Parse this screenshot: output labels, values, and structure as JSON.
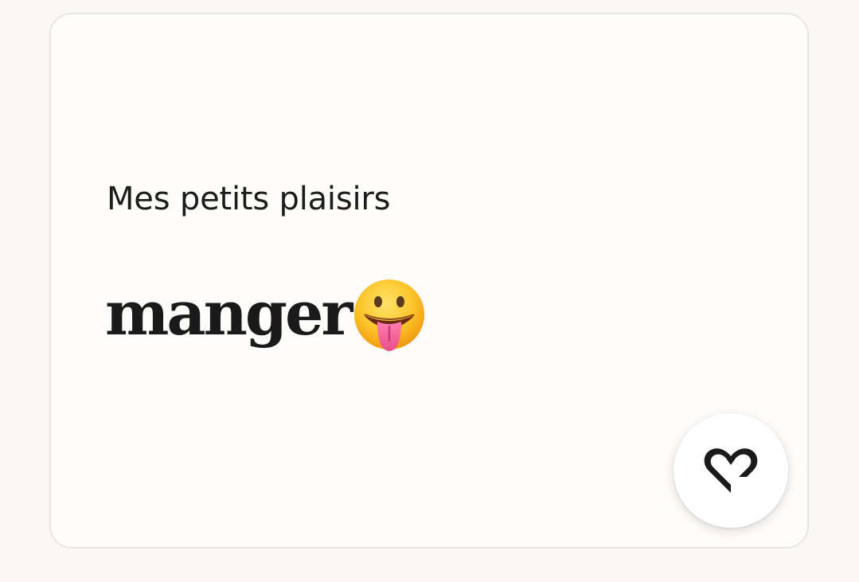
{
  "card": {
    "prompt": "Mes petits plaisirs",
    "answer": "manger",
    "answer_emoji": "face-with-tongue"
  },
  "like_button": {
    "icon": "heart-like-icon",
    "icon_color": "#1a1a1a"
  },
  "colors": {
    "page_background": "#f9f8f7",
    "card_background": "#fefdfb",
    "card_border": "#e8e6e3",
    "text": "#1a1a1a"
  }
}
